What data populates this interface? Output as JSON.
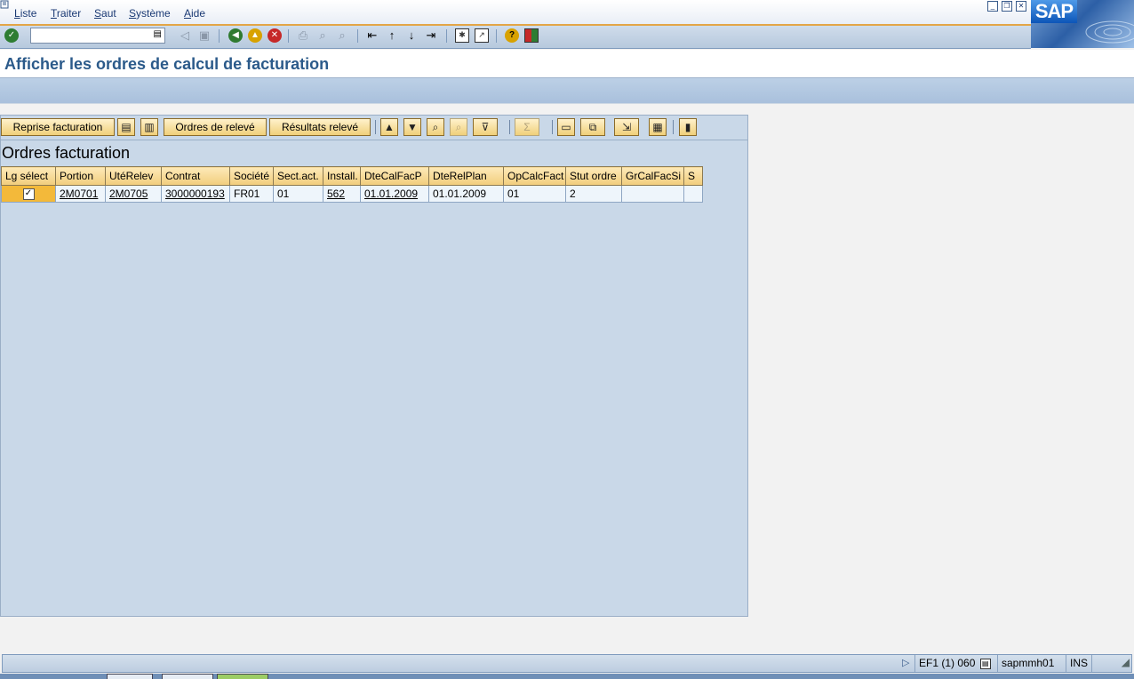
{
  "menu": {
    "items": [
      "Liste",
      "Traiter",
      "Saut",
      "Système",
      "Aide"
    ]
  },
  "brand": {
    "logo_text": "SAP",
    "accent": "#e3a546",
    "title_color": "#2b5a8a"
  },
  "command_field": {
    "value": ""
  },
  "toolbar_icons": [
    "enter-icon",
    "save-icon",
    "back-icon",
    "exit-icon",
    "cancel-icon",
    "print-icon",
    "find-icon",
    "find-next-icon",
    "first-page-icon",
    "previous-page-icon",
    "next-page-icon",
    "last-page-icon",
    "new-session-icon",
    "shortcut-icon",
    "help-icon",
    "layout-icon"
  ],
  "page": {
    "title": "Afficher les ordres de calcul de facturation"
  },
  "alv": {
    "buttons": {
      "reprise": "Reprise facturation",
      "releve": "Ordres de relevé",
      "resultats": "Résultats relevé"
    },
    "title": "Ordres facturation",
    "columns": [
      "Lg sélect",
      "Portion",
      "UtéRelev",
      "Contrat",
      "Société",
      "Sect.act.",
      "Install.",
      "DteCalFacP",
      "DteRelPlan",
      "OpCalcFact",
      "Stut ordre",
      "GrCalFacSi",
      "S"
    ],
    "rows": [
      {
        "selected": true,
        "portion": "2M0701",
        "uterelev": "2M0705",
        "contrat": "3000000193",
        "societe": "FR01",
        "sectact": "01",
        "install": "562",
        "dtecalfacp": "01.01.2009",
        "dterelplan": "01.01.2009",
        "opcalcfact": "01",
        "stutordre": "2",
        "grcalfacsi": "",
        "s": ""
      }
    ]
  },
  "status": {
    "system": "EF1 (1) 060",
    "server": "sapmmh01",
    "mode": "INS"
  }
}
